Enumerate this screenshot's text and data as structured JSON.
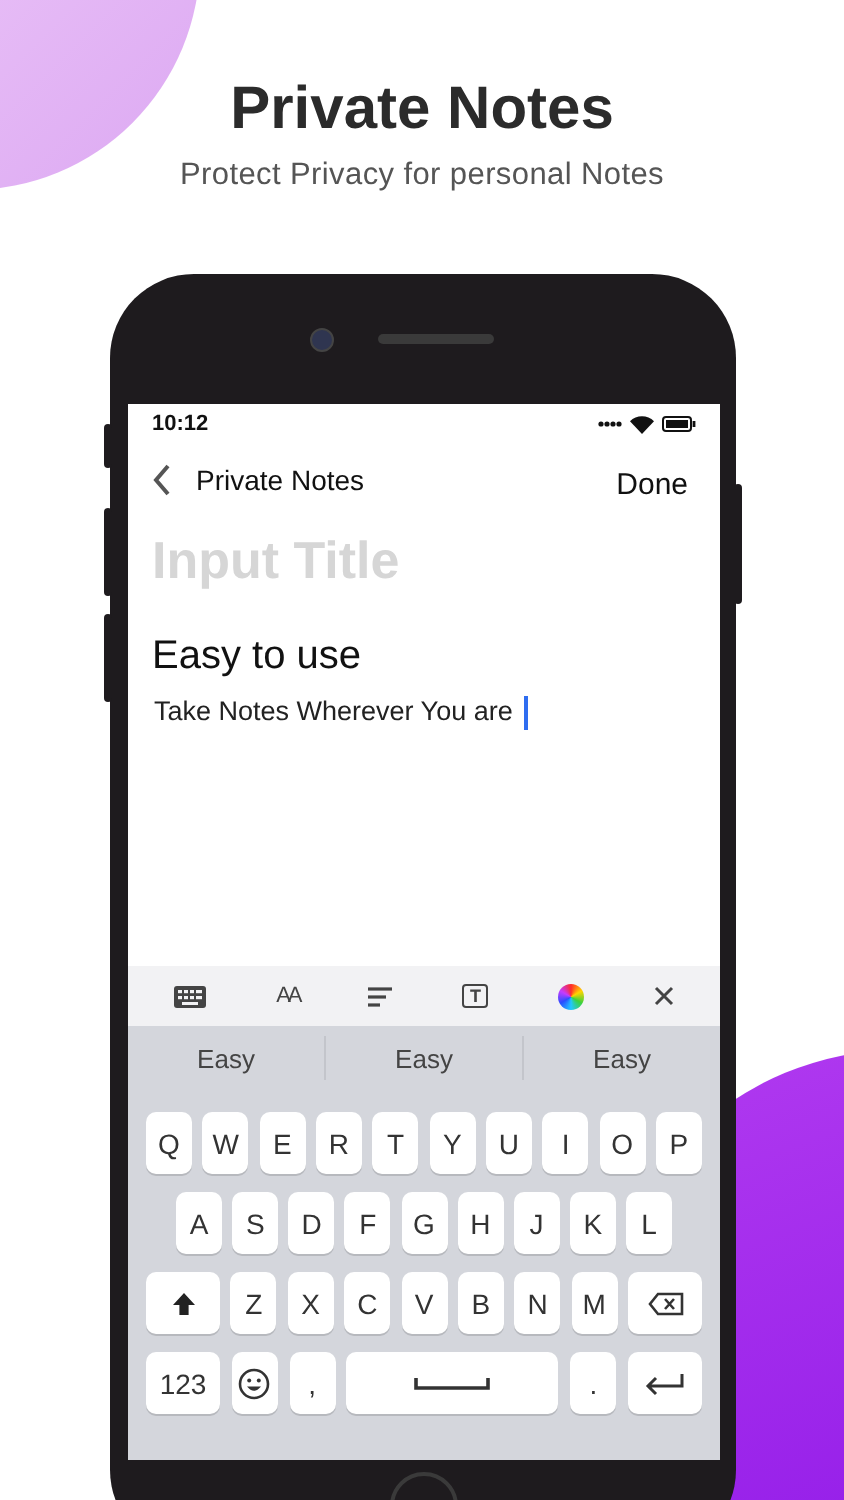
{
  "header": {
    "title": "Private Notes",
    "subtitle": "Protect Privacy for personal Notes"
  },
  "status_bar": {
    "time": "10:12"
  },
  "nav": {
    "back_label": "Private Notes",
    "action": "Done"
  },
  "editor": {
    "title_placeholder": "Input Title",
    "heading": "Easy to use",
    "body": "Take Notes Wherever You are"
  },
  "toolbar": [
    {
      "kind": "keyboard"
    },
    {
      "kind": "text-size",
      "label": "AA"
    },
    {
      "kind": "align"
    },
    {
      "kind": "text-box",
      "label": "T"
    },
    {
      "kind": "color"
    },
    {
      "kind": "close"
    }
  ],
  "suggestions": [
    "Easy",
    "Easy",
    "Easy"
  ],
  "keyboard": {
    "rows": [
      {
        "keys": [
          {
            "kind": "char",
            "label": "Q"
          },
          {
            "kind": "char",
            "label": "W"
          },
          {
            "kind": "char",
            "label": "E"
          },
          {
            "kind": "char",
            "label": "R"
          },
          {
            "kind": "char",
            "label": "T"
          },
          {
            "kind": "char",
            "label": "Y"
          },
          {
            "kind": "char",
            "label": "U"
          },
          {
            "kind": "char",
            "label": "I"
          },
          {
            "kind": "char",
            "label": "O"
          },
          {
            "kind": "char",
            "label": "P"
          }
        ]
      },
      {
        "keys": [
          {
            "kind": "char",
            "label": "A"
          },
          {
            "kind": "char",
            "label": "S"
          },
          {
            "kind": "char",
            "label": "D"
          },
          {
            "kind": "char",
            "label": "F"
          },
          {
            "kind": "char",
            "label": "G"
          },
          {
            "kind": "char",
            "label": "H"
          },
          {
            "kind": "char",
            "label": "J"
          },
          {
            "kind": "char",
            "label": "K"
          },
          {
            "kind": "char",
            "label": "L"
          }
        ]
      },
      {
        "keys": [
          {
            "kind": "shift"
          },
          {
            "kind": "char",
            "label": "Z"
          },
          {
            "kind": "char",
            "label": "X"
          },
          {
            "kind": "char",
            "label": "C"
          },
          {
            "kind": "char",
            "label": "V"
          },
          {
            "kind": "char",
            "label": "B"
          },
          {
            "kind": "char",
            "label": "N"
          },
          {
            "kind": "char",
            "label": "M"
          },
          {
            "kind": "backspace"
          }
        ]
      },
      {
        "keys": [
          {
            "kind": "numbers",
            "label": "123"
          },
          {
            "kind": "emoji"
          },
          {
            "kind": "char",
            "label": ","
          },
          {
            "kind": "space"
          },
          {
            "kind": "char",
            "label": "."
          },
          {
            "kind": "enter"
          }
        ]
      }
    ]
  }
}
